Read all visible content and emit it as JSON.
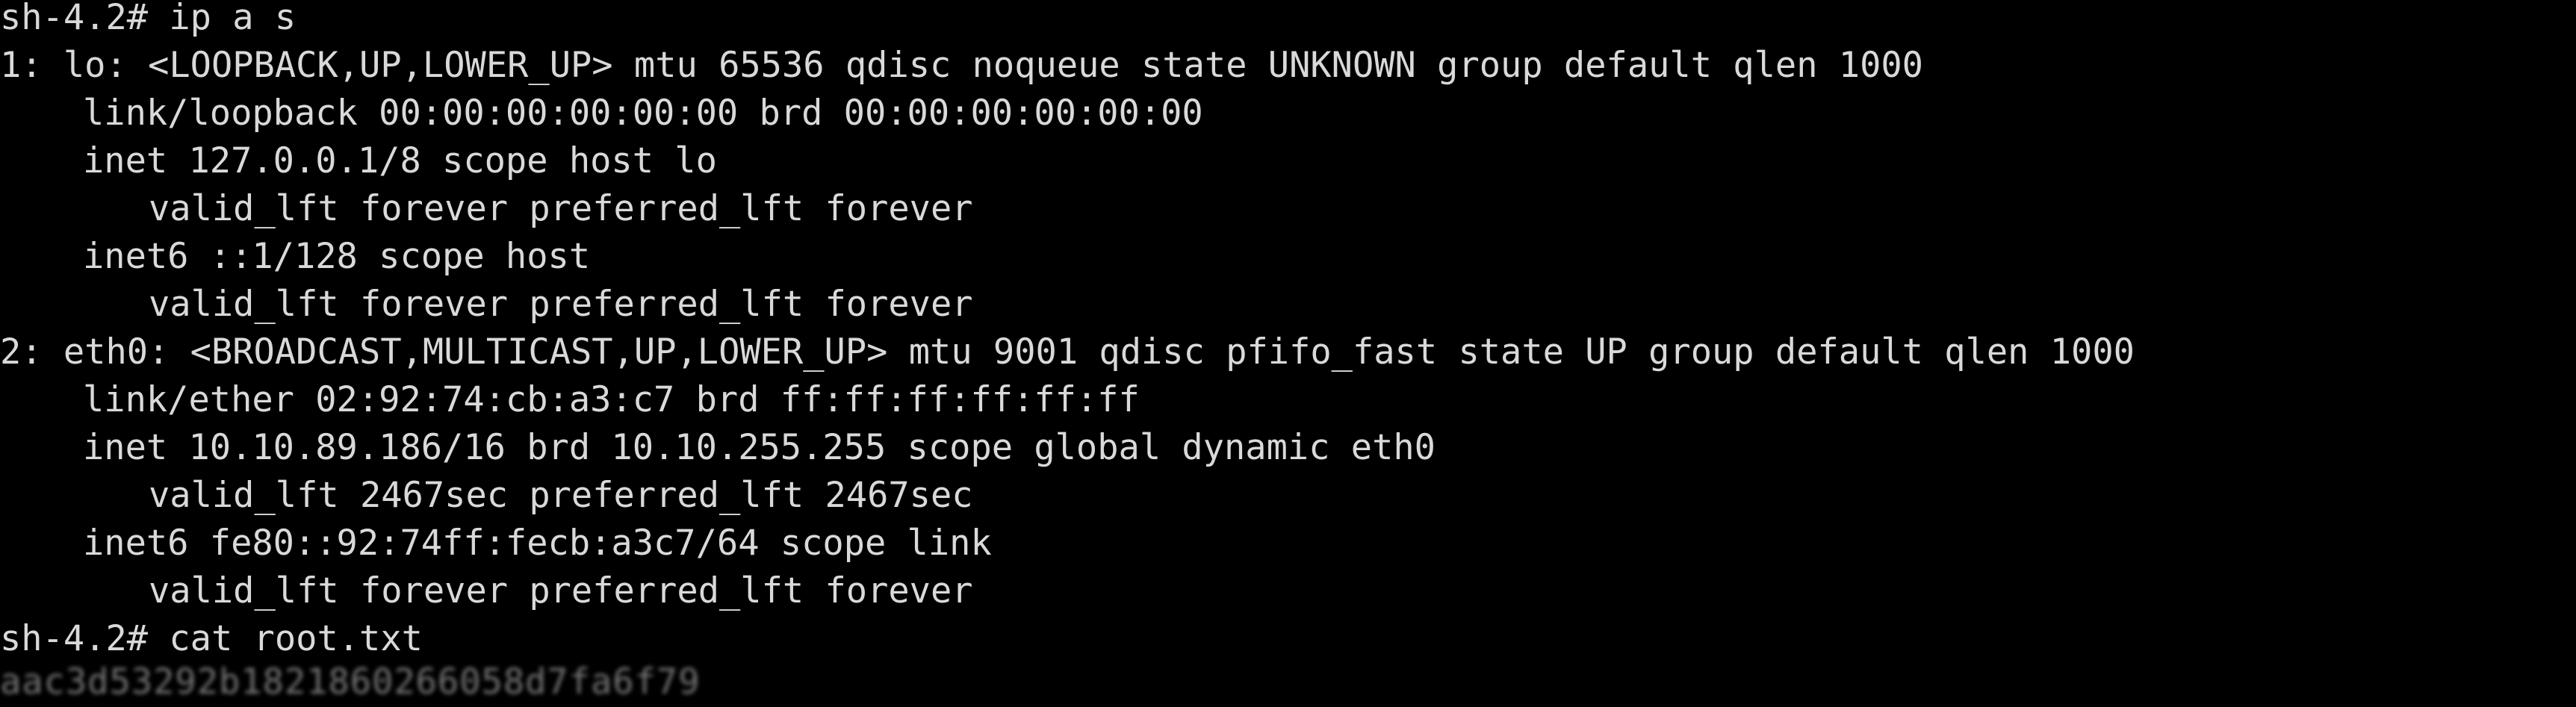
{
  "terminal": {
    "lines": [
      "sh-4.2# ip a s",
      "1: lo: <LOOPBACK,UP,LOWER_UP> mtu 65536 qdisc noqueue state UNKNOWN group default qlen 1000",
      "link/loopback 00:00:00:00:00:00 brd 00:00:00:00:00:00",
      "inet 127.0.0.1/8 scope host lo",
      "valid_lft forever preferred_lft forever",
      "inet6 ::1/128 scope host",
      "valid_lft forever preferred_lft forever",
      "2: eth0: <BROADCAST,MULTICAST,UP,LOWER_UP> mtu 9001 qdisc pfifo_fast state UP group default qlen 1000",
      "link/ether 02:92:74:cb:a3:c7 brd ff:ff:ff:ff:ff:ff",
      "inet 10.10.89.186/16 brd 10.10.255.255 scope global dynamic eth0",
      "valid_lft 2467sec preferred_lft 2467sec",
      "inet6 fe80::92:74ff:fecb:a3c7/64 scope link",
      "valid_lft forever preferred_lft forever",
      "sh-4.2# cat root.txt"
    ],
    "redacted_output": "aac3d53292b1821860266058d7fa6f79"
  }
}
